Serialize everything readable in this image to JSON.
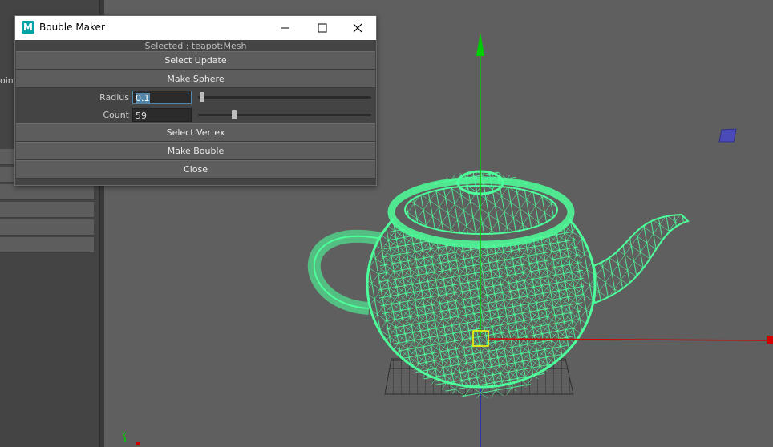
{
  "dialog": {
    "title": "Bouble Maker",
    "app_icon_letter": "M",
    "selected_text": "Selected : teapot:Mesh",
    "buttons": {
      "select_update": "Select Update",
      "make_sphere": "Make Sphere",
      "select_vertex": "Select Vertex",
      "make_bouble": "Make Bouble",
      "close": "Close"
    },
    "radius": {
      "label": "Radius",
      "value": "0.1",
      "slider_fraction": 0.01
    },
    "count": {
      "label": "Count",
      "value": "59",
      "slider_fraction": 0.2
    }
  },
  "left_panel": {
    "label": "oint"
  },
  "viewport": {
    "axis_label": "y"
  },
  "colors": {
    "wireframe": "#4dff9a",
    "y_axis": "#00cc00",
    "x_axis": "#d40000",
    "z_axis": "#2222cc",
    "pivot": "#ffff00",
    "cube_marker": "#4a4ab8"
  }
}
